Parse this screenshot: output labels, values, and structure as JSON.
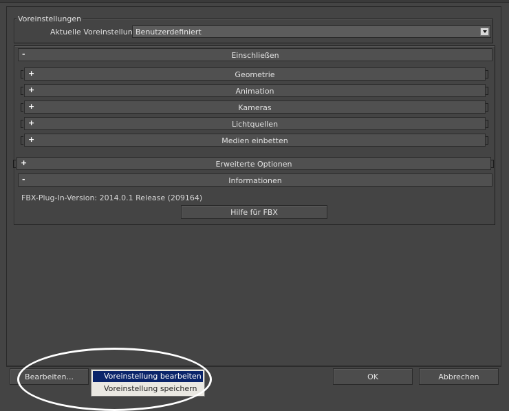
{
  "presets": {
    "group_title": "Voreinstellungen",
    "current_label": "Aktuelle Voreinstellung:",
    "current_value": "Benutzerdefiniert"
  },
  "rollouts": {
    "include": {
      "sign": "-",
      "title": "Einschließen"
    },
    "geometry": {
      "sign": "+",
      "title": "Geometrie"
    },
    "animation": {
      "sign": "+",
      "title": "Animation"
    },
    "cameras": {
      "sign": "+",
      "title": "Kameras"
    },
    "lights": {
      "sign": "+",
      "title": "Lichtquellen"
    },
    "embed_media": {
      "sign": "+",
      "title": "Medien einbetten"
    },
    "advanced": {
      "sign": "+",
      "title": "Erweiterte Optionen"
    },
    "information": {
      "sign": "-",
      "title": "Informationen"
    }
  },
  "info": {
    "version_text": "FBX-Plug-In-Version: 2014.0.1 Release (209164)",
    "help_button": "Hilfe für FBX"
  },
  "footer": {
    "edit_button": "Bearbeiten...",
    "ok_button": "OK",
    "cancel_button": "Abbrechen"
  },
  "edit_menu": {
    "items": [
      "Voreinstellung bearbeiten",
      "Voreinstellung speichern"
    ]
  }
}
